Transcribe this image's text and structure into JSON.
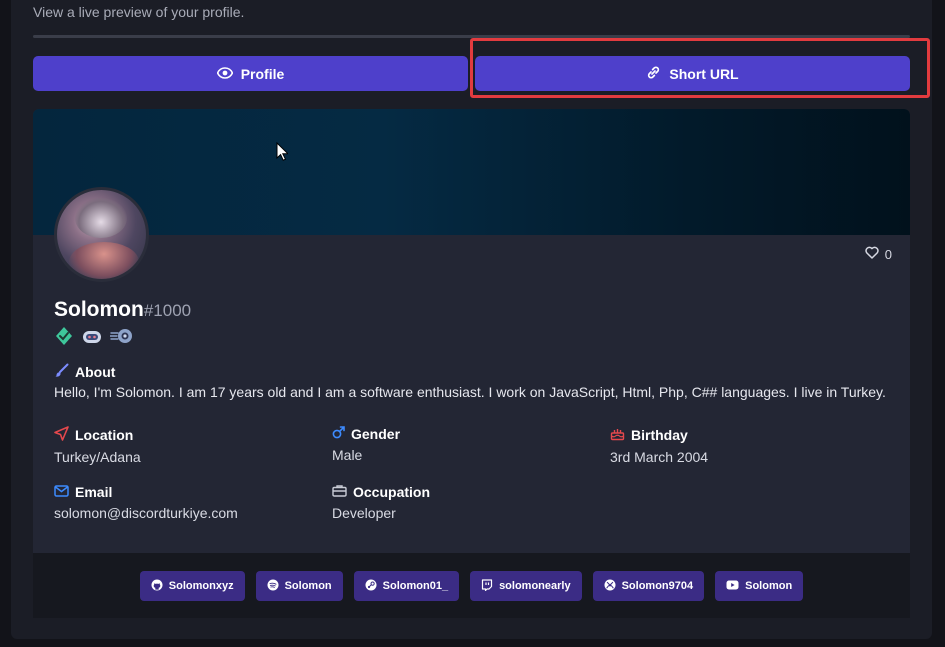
{
  "header": {
    "subtitle": "View a live preview of your profile."
  },
  "tabs": [
    {
      "label": "Profile",
      "icon": "eye-icon"
    },
    {
      "label": "Short URL",
      "icon": "link-icon"
    }
  ],
  "profile": {
    "likes": "0",
    "username": "Solomon",
    "discriminator": "#1000",
    "about_label": "About",
    "about_text": "Hello, I'm Solomon. I am 17 years old and I am a software enthusiast. I work on JavaScript, Html, Php, C## languages. I live in Turkey.",
    "fields": {
      "location": {
        "label": "Location",
        "value": "Turkey/Adana"
      },
      "gender": {
        "label": "Gender",
        "value": "Male"
      },
      "birthday": {
        "label": "Birthday",
        "value": "3rd March 2004"
      },
      "email": {
        "label": "Email",
        "value": "solomon@discordturkiye.com"
      },
      "occupation": {
        "label": "Occupation",
        "value": "Developer"
      }
    }
  },
  "socials": [
    {
      "label": "Solomonxyz",
      "icon": "github-icon"
    },
    {
      "label": "Solomon",
      "icon": "spotify-icon"
    },
    {
      "label": "Solomon01_",
      "icon": "steam-icon"
    },
    {
      "label": "solomonearly",
      "icon": "twitch-icon"
    },
    {
      "label": "Solomon9704",
      "icon": "xbox-icon"
    },
    {
      "label": "Solomon",
      "icon": "youtube-icon"
    }
  ],
  "colors": {
    "accent": "#4e40cb",
    "highlight": "#e23b3f",
    "social": "#3b2c85"
  }
}
